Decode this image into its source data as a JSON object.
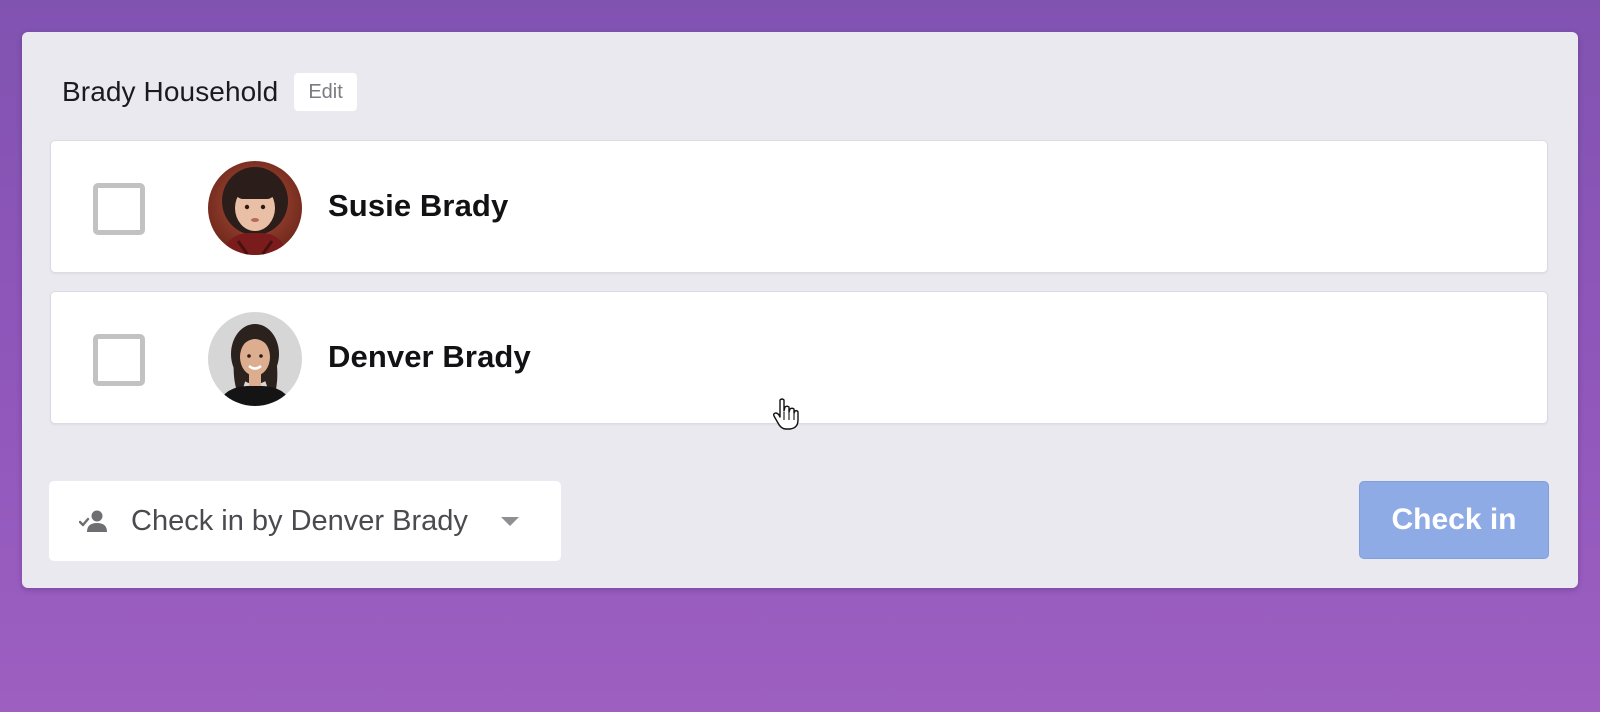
{
  "household": {
    "title": "Brady Household",
    "edit_label": "Edit"
  },
  "people": [
    {
      "name": "Susie Brady",
      "checked": false,
      "avatar_icon": "child-portrait-photo"
    },
    {
      "name": "Denver Brady",
      "checked": false,
      "avatar_icon": "adult-portrait-photo"
    }
  ],
  "footer": {
    "checkin_by_icon": "person-check-icon",
    "checkin_by_label": "Check in by Denver Brady",
    "dropdown_icon": "caret-down-icon",
    "checkin_button_label": "Check in"
  },
  "colors": {
    "background_top": "#8153b1",
    "background_bottom": "#9d60c1",
    "panel": "#ebe9f0",
    "checkin_button": "#8eabe6",
    "checkbox_border": "#c2c2c2"
  },
  "pointer_icon": "hand-pointer-cursor-icon"
}
